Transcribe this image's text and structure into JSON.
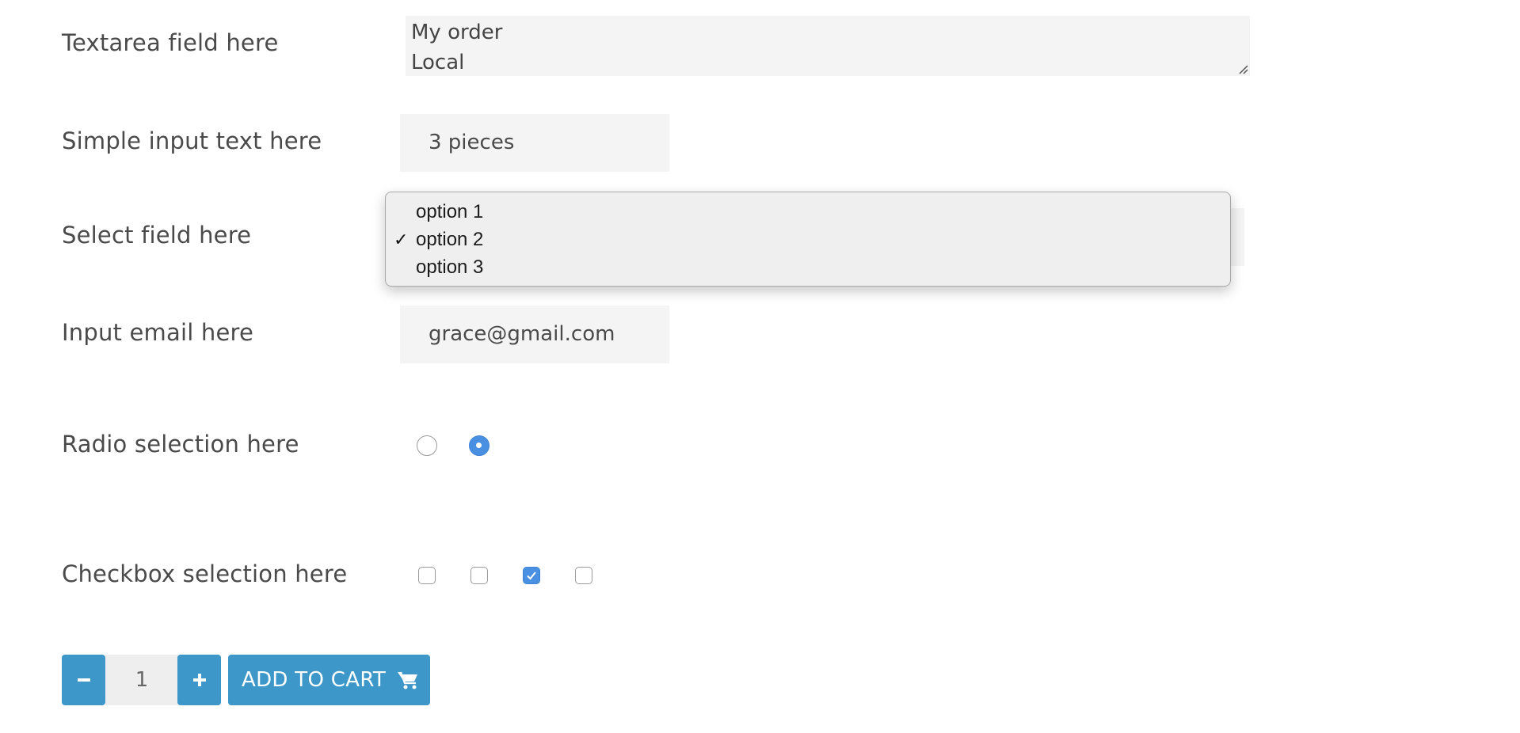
{
  "form": {
    "textarea": {
      "label": "Textarea field here",
      "lines": [
        "My order",
        "Local"
      ]
    },
    "text_input": {
      "label": "Simple input text here",
      "value": "3 pieces"
    },
    "select": {
      "label": "Select field here",
      "options": [
        "option 1",
        "option 2",
        "option 3"
      ],
      "selected": "option 2"
    },
    "email": {
      "label": "Input email here",
      "value": "grace@gmail.com"
    },
    "radio": {
      "label": "Radio selection here",
      "states": [
        false,
        true
      ]
    },
    "checkbox": {
      "label": "Checkbox selection here",
      "states": [
        false,
        false,
        true,
        false
      ]
    }
  },
  "cart": {
    "minus_icon": "minus-icon",
    "plus_icon": "plus-icon",
    "quantity": "1",
    "add_label": "ADD TO CART",
    "cart_icon": "cart-icon"
  },
  "colors": {
    "accent": "#3d97c8",
    "checked": "#4a90e2",
    "field_bg": "#f4f4f4"
  }
}
